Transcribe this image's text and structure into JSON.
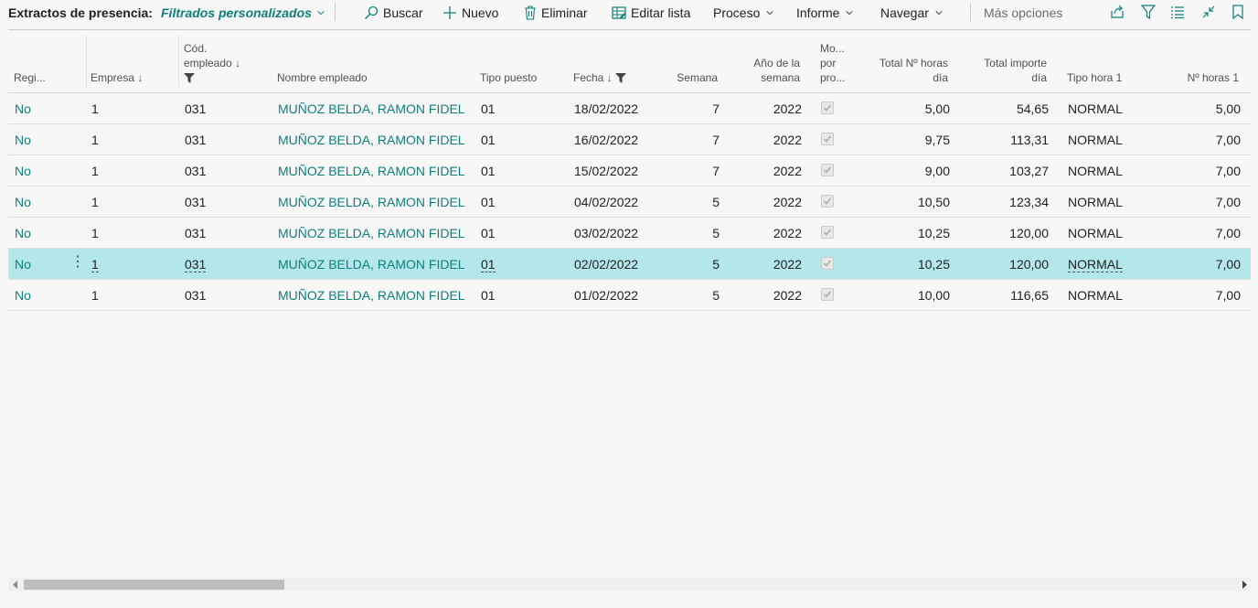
{
  "toolbar": {
    "page_title": "Extractos de presencia:",
    "view_label": "Filtrados personalizados",
    "buscar": "Buscar",
    "nuevo": "Nuevo",
    "eliminar": "Eliminar",
    "editar_lista": "Editar lista",
    "proceso": "Proceso",
    "informe": "Informe",
    "navegar": "Navegar",
    "mas_opciones": "Más opciones"
  },
  "columns": {
    "registro": "Regi...",
    "empresa": "Empresa",
    "cod_line1": "Cód.",
    "cod_line2": "empleado",
    "nombre": "Nombre empleado",
    "tipo_puesto": "Tipo puesto",
    "fecha": "Fecha",
    "semana": "Semana",
    "anio_line1": "Año de la",
    "anio_line2": "semana",
    "mo_line1": "Mo...",
    "mo_line2": "por",
    "mo_line3": "pro...",
    "total_horas_line1": "Total Nº horas",
    "total_horas_line2": "día",
    "total_importe_line1": "Total importe",
    "total_importe_line2": "día",
    "tipo_hora": "Tipo hora 1",
    "n_horas": "Nº horas 1"
  },
  "rows": [
    {
      "registro": "No",
      "empresa": "1",
      "cod": "031",
      "nombre": "MUÑOZ BELDA, RAMON FIDEL",
      "tipo_puesto": "01",
      "fecha": "18/02/2022",
      "semana": "7",
      "anio": "2022",
      "total_horas": "5,00",
      "total_importe": "54,65",
      "tipo_hora": "NORMAL",
      "n_horas": "5,00"
    },
    {
      "registro": "No",
      "empresa": "1",
      "cod": "031",
      "nombre": "MUÑOZ BELDA, RAMON FIDEL",
      "tipo_puesto": "01",
      "fecha": "16/02/2022",
      "semana": "7",
      "anio": "2022",
      "total_horas": "9,75",
      "total_importe": "113,31",
      "tipo_hora": "NORMAL",
      "n_horas": "7,00"
    },
    {
      "registro": "No",
      "empresa": "1",
      "cod": "031",
      "nombre": "MUÑOZ BELDA, RAMON FIDEL",
      "tipo_puesto": "01",
      "fecha": "15/02/2022",
      "semana": "7",
      "anio": "2022",
      "total_horas": "9,00",
      "total_importe": "103,27",
      "tipo_hora": "NORMAL",
      "n_horas": "7,00"
    },
    {
      "registro": "No",
      "empresa": "1",
      "cod": "031",
      "nombre": "MUÑOZ BELDA, RAMON FIDEL",
      "tipo_puesto": "01",
      "fecha": "04/02/2022",
      "semana": "5",
      "anio": "2022",
      "total_horas": "10,50",
      "total_importe": "123,34",
      "tipo_hora": "NORMAL",
      "n_horas": "7,00"
    },
    {
      "registro": "No",
      "empresa": "1",
      "cod": "031",
      "nombre": "MUÑOZ BELDA, RAMON FIDEL",
      "tipo_puesto": "01",
      "fecha": "03/02/2022",
      "semana": "5",
      "anio": "2022",
      "total_horas": "10,25",
      "total_importe": "120,00",
      "tipo_hora": "NORMAL",
      "n_horas": "7,00"
    },
    {
      "registro": "No",
      "empresa": "1",
      "cod": "031",
      "nombre": "MUÑOZ BELDA, RAMON FIDEL",
      "tipo_puesto": "01",
      "fecha": "02/02/2022",
      "semana": "5",
      "anio": "2022",
      "total_horas": "10,25",
      "total_importe": "120,00",
      "tipo_hora": "NORMAL",
      "n_horas": "7,00"
    },
    {
      "registro": "No",
      "empresa": "1",
      "cod": "031",
      "nombre": "MUÑOZ BELDA, RAMON FIDEL",
      "tipo_puesto": "01",
      "fecha": "01/02/2022",
      "semana": "5",
      "anio": "2022",
      "total_horas": "10,00",
      "total_importe": "116,65",
      "tipo_hora": "NORMAL",
      "n_horas": "7,00"
    }
  ],
  "colors": {
    "accent": "#0e7f7a",
    "selected_row": "#b4e7ea"
  }
}
